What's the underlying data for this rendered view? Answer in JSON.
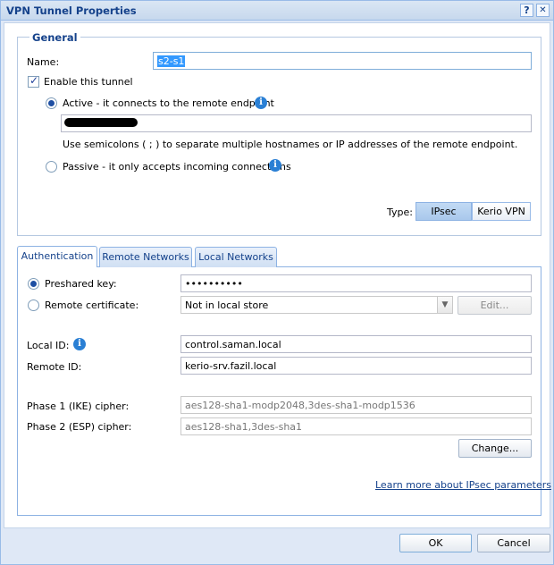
{
  "window": {
    "title": "VPN Tunnel Properties",
    "help_glyph": "?",
    "close_glyph": "✕"
  },
  "general": {
    "legend": "General",
    "name_label": "Name:",
    "name_value": "s2-s1",
    "enable_label": "Enable this tunnel",
    "enable_checked": true,
    "active_label": "Active - it connects to the remote endpoint",
    "active_selected": true,
    "endpoint_value": "",
    "endpoint_hint": "Use semicolons ( ; ) to separate multiple hostnames or IP addresses of the remote endpoint.",
    "passive_label": "Passive - it only accepts incoming connections",
    "type_label": "Type:",
    "type_options": [
      "IPsec",
      "Kerio VPN"
    ],
    "type_selected": "IPsec"
  },
  "tabs": [
    {
      "label": "Authentication",
      "active": true
    },
    {
      "label": "Remote Networks",
      "active": false
    },
    {
      "label": "Local Networks",
      "active": false
    }
  ],
  "auth": {
    "preshared_label": "Preshared key:",
    "preshared_value": "••••••••••",
    "remote_cert_label": "Remote certificate:",
    "remote_cert_value": "Not in local store",
    "edit_button": "Edit...",
    "local_id_label": "Local ID:",
    "local_id_value": "control.saman.local",
    "remote_id_label": "Remote ID:",
    "remote_id_value": "kerio-srv.fazil.local",
    "phase1_label": "Phase 1 (IKE) cipher:",
    "phase1_value": "aes128-sha1-modp2048,3des-sha1-modp1536",
    "phase2_label": "Phase 2 (ESP) cipher:",
    "phase2_value": "aes128-sha1,3des-sha1",
    "change_button": "Change...",
    "learn_more_link": "Learn more about IPsec parameters"
  },
  "footer": {
    "ok_button": "OK",
    "cancel_button": "Cancel"
  },
  "icons": {
    "info": "i",
    "check": "✓",
    "dropdown": "▼"
  },
  "colors": {
    "title_text": "#15428b",
    "accent_blue": "#2a7fd4",
    "selection": "#3399ff"
  }
}
